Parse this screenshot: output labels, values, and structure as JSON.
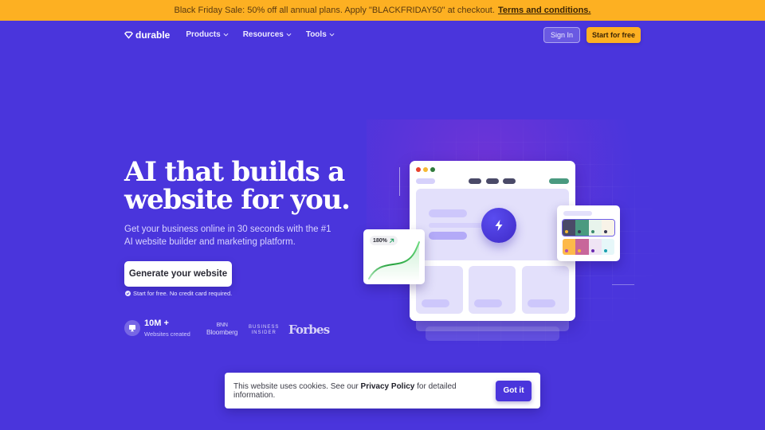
{
  "banner": {
    "text": "Black Friday Sale: 50% off all annual plans. Apply \"BLACKFRIDAY50\" at checkout.",
    "link_label": "Terms and conditions."
  },
  "nav": {
    "logo_text": "durable",
    "items": [
      {
        "label": "Products",
        "icon": "chevron-down-icon"
      },
      {
        "label": "Resources",
        "icon": "chevron-down-icon"
      },
      {
        "label": "Tools",
        "icon": "chevron-down-icon"
      }
    ],
    "signin_label": "Sign In",
    "start_label": "Start for free"
  },
  "hero": {
    "title_line1": "AI that builds a",
    "title_line2": "website for you.",
    "subtitle": "Get your business online in 30 seconds with the #1 AI website builder and marketing platform.",
    "cta_label": "Generate your website",
    "note": "Start for free. No credit card required.",
    "stat_value": "10M +",
    "stat_label": "Websites created",
    "press": {
      "bnn_top": "BNN",
      "bnn_bottom": "Bloomberg",
      "bi_top": "BUSINESS",
      "bi_bottom": "INSIDER",
      "forbes": "Forbes"
    }
  },
  "illustration": {
    "growth_badge": "180%",
    "window_dots": [
      "#e8412c",
      "#f6b931",
      "#2f7a3a"
    ],
    "palettes": [
      {
        "selected": true,
        "swatches": [
          "#4a4a68",
          "#4a9a80",
          "#e8f4ec",
          "#f8f3e8"
        ],
        "dots": [
          "#f6b931",
          "#3a3a55",
          "#3a8a6e",
          "#3a3a55"
        ]
      },
      {
        "selected": false,
        "swatches": [
          "#fdb94a",
          "#c8669a",
          "#efe4f4",
          "#e6f7f9"
        ],
        "dots": [
          "#b04ab8",
          "#f6b931",
          "#6a2ab0",
          "#1aa0b0"
        ]
      }
    ]
  },
  "cookie": {
    "text_before": "This website uses cookies. See our ",
    "link_label": "Privacy Policy",
    "text_after": " for detailed information.",
    "button_label": "Got it"
  },
  "colors": {
    "brand": "#4a35dc",
    "accent": "#fdb022"
  }
}
